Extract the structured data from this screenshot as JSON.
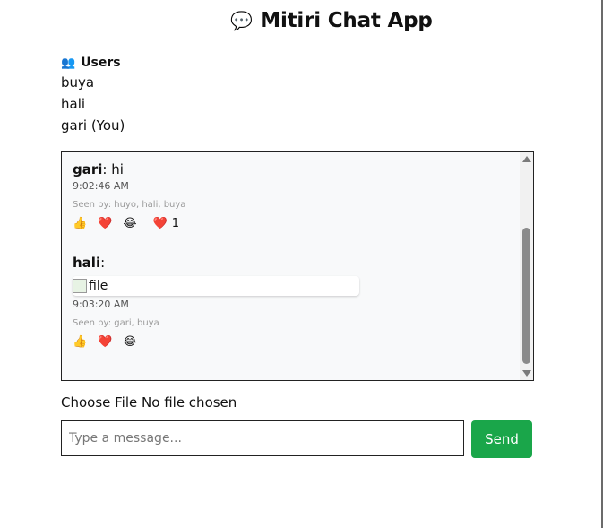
{
  "header": {
    "icon": "speech-bubble-icon",
    "title": "Mitiri Chat App"
  },
  "users": {
    "heading": "Users",
    "icon": "users-icon",
    "list": [
      "buya",
      "hali",
      "gari (You)"
    ]
  },
  "messages": [
    {
      "sender": "gari",
      "separator": ":",
      "text": " hi",
      "time": "9:02:46 AM",
      "seen": "Seen by: huyo, hali, buya",
      "reactions": [
        "👍",
        "❤️",
        "😂"
      ],
      "active_reaction": "❤️",
      "active_count": "1"
    },
    {
      "sender": "hali",
      "separator": ":",
      "attachment_alt": "file",
      "time": "9:03:20 AM",
      "seen": "Seen by: gari, buya",
      "reactions": [
        "👍",
        "❤️",
        "😂"
      ]
    }
  ],
  "file_input": {
    "button": "Choose File",
    "status": "No file chosen"
  },
  "composer": {
    "placeholder": "Type a message...",
    "send_label": "Send"
  },
  "colors": {
    "send_button": "#1aa64a",
    "chat_bg": "#f8f9fa"
  }
}
